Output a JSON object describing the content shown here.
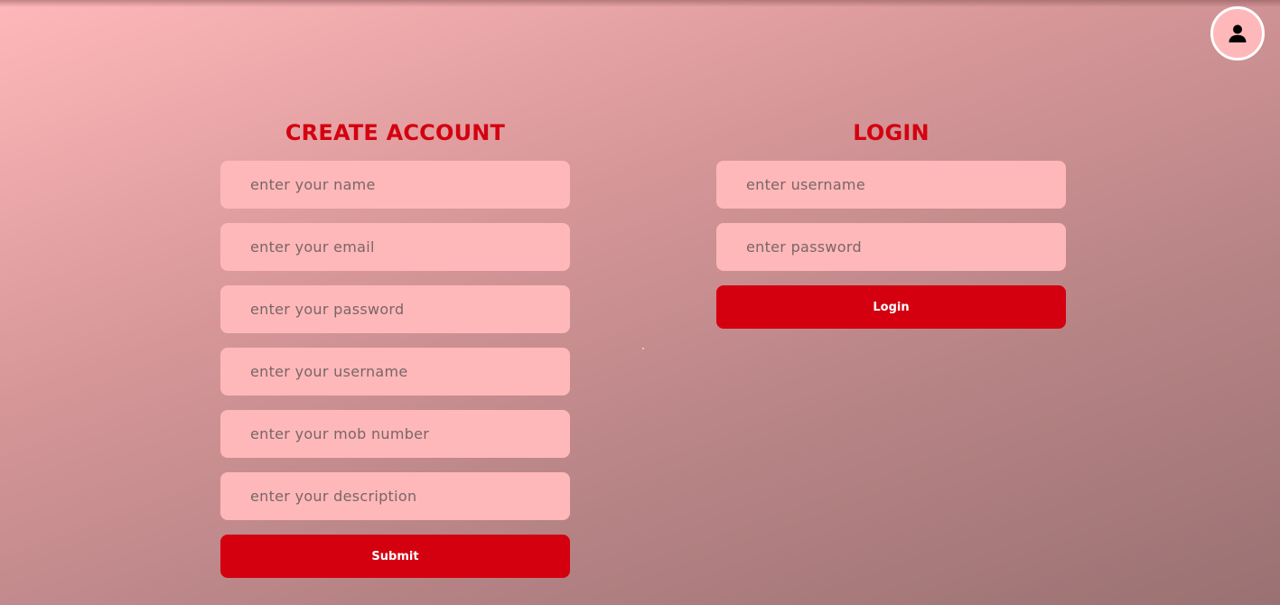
{
  "header": {
    "profile_icon": "user-icon"
  },
  "create_account": {
    "title": "CREATE ACCOUNT",
    "fields": {
      "name": {
        "placeholder": "enter your name",
        "value": ""
      },
      "email": {
        "placeholder": "enter your email",
        "value": ""
      },
      "password": {
        "placeholder": "enter your password",
        "value": ""
      },
      "username": {
        "placeholder": "enter your username",
        "value": ""
      },
      "mob_number": {
        "placeholder": "enter your mob number",
        "value": ""
      },
      "description": {
        "placeholder": "enter your description",
        "value": ""
      }
    },
    "submit_label": "Submit"
  },
  "login": {
    "title": "LOGIN",
    "fields": {
      "username": {
        "placeholder": "enter username",
        "value": ""
      },
      "password": {
        "placeholder": "enter password",
        "value": ""
      }
    },
    "login_label": "Login"
  },
  "colors": {
    "accent": "#d4000f",
    "title": "#d40010",
    "field_bg": "#ffb8b9",
    "bg_start": "#ffb8b9",
    "bg_end": "#9a7172"
  }
}
